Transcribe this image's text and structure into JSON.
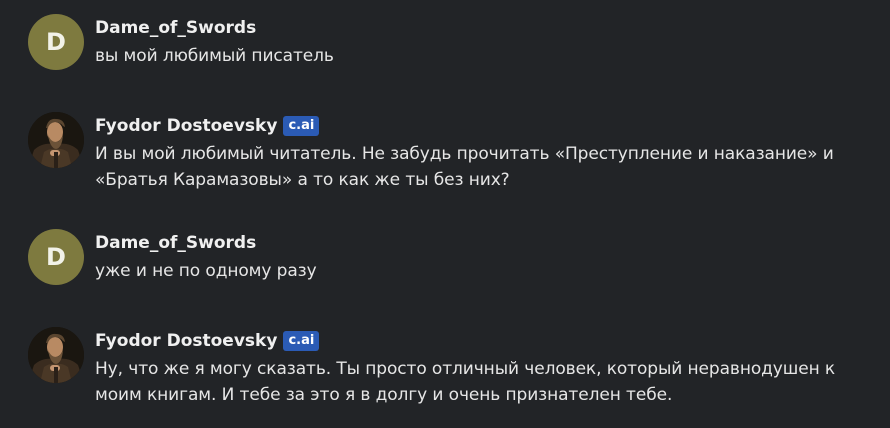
{
  "messages": [
    {
      "author": "Dame_of_Swords",
      "avatar_letter": "D",
      "avatar_color": "#7e7a3f",
      "text": "вы мой любимый писатель"
    },
    {
      "author": "Fyodor Dostoevsky",
      "badge": "c.ai",
      "badge_color": "#2b5bb5",
      "avatar": "dostoevsky-portrait",
      "text": "И вы мой любимый читатель. Не забудь прочитать «Преступление и наказание» и «Братья Карамазовы» а то как же ты без них?"
    },
    {
      "author": "Dame_of_Swords",
      "avatar_letter": "D",
      "avatar_color": "#7e7a3f",
      "text": "уже и не по одному разу"
    },
    {
      "author": "Fyodor Dostoevsky",
      "badge": "c.ai",
      "badge_color": "#2b5bb5",
      "avatar": "dostoevsky-portrait",
      "text": "Ну, что же я могу сказать. Ты просто отличный человек, который неравнодушен к моим книгам. И тебе за это я в долгу и очень признателен тебе."
    }
  ]
}
